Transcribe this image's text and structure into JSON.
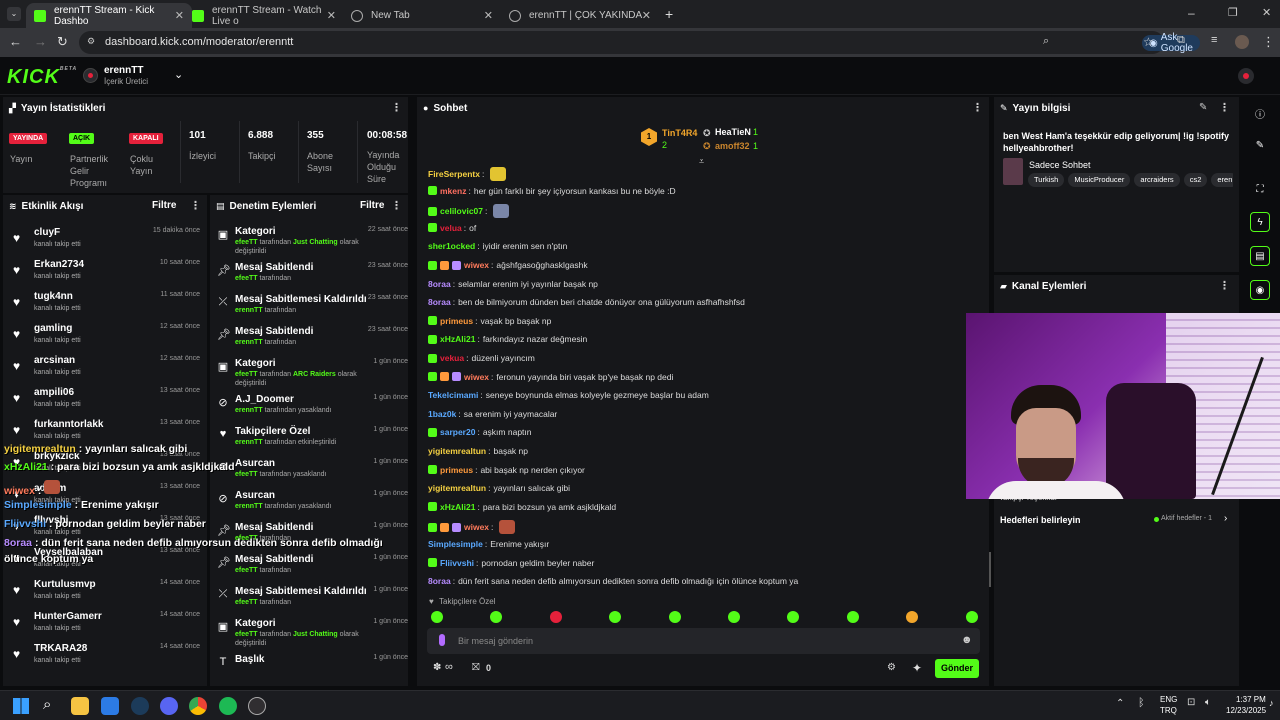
{
  "browser": {
    "tabs": [
      {
        "title": "erennTT Stream - Kick Dashbo",
        "active": true,
        "icon": "kick-icon"
      },
      {
        "title": "erennTT Stream - Watch Live o",
        "active": false,
        "icon": "kick-icon"
      },
      {
        "title": "New Tab",
        "active": false,
        "icon": "globe-icon"
      },
      {
        "title": "erennTT | ÇOK YAKINDA",
        "active": false,
        "icon": "globe-icon"
      }
    ],
    "url": "dashboard.kick.com/moderator/erenntt",
    "ask_google": "Ask Google"
  },
  "header": {
    "logo": "KICK",
    "logo_beta": "BETA",
    "channel_name": "erennTT",
    "channel_role": "İçerik Üretici"
  },
  "stats": {
    "title": "Yayın İstatistikleri",
    "badges": [
      {
        "badge": "YAYINDA",
        "label": "Yayın",
        "color": "#e5213b",
        "text_color": "#ffffff"
      },
      {
        "badge": "AÇIK",
        "label": "Partnerlik Gelir Programı",
        "color": "#53fc18",
        "text_color": "#000000"
      },
      {
        "badge": "KAPALI",
        "label": "Çoklu Yayın",
        "color": "#e5213b",
        "text_color": "#ffffff"
      }
    ],
    "numbers": [
      {
        "value": "101",
        "label": "İzleyici"
      },
      {
        "value": "6.888",
        "label": "Takipçi"
      },
      {
        "value": "355",
        "label": "Abone Sayısı"
      },
      {
        "value": "00:08:58",
        "label": "Yayında Olduğu Süre"
      }
    ]
  },
  "activity": {
    "title": "Etkinlik Akışı",
    "filter": "Filtre",
    "items": [
      {
        "name": "cluyF",
        "sub": "kanalı takip etti",
        "time": "15 dakika önce"
      },
      {
        "name": "Erkan2734",
        "sub": "kanalı takip etti",
        "time": "10 saat önce"
      },
      {
        "name": "tugk4nn",
        "sub": "kanalı takip etti",
        "time": "11 saat önce"
      },
      {
        "name": "gamling",
        "sub": "kanalı takip etti",
        "time": "12 saat önce"
      },
      {
        "name": "arcsinan",
        "sub": "kanalı takip etti",
        "time": "12 saat önce"
      },
      {
        "name": "ampili06",
        "sub": "kanalı takip etti",
        "time": "13 saat önce"
      },
      {
        "name": "furkanntorlakk",
        "sub": "kanalı takip etti",
        "time": "13 saat önce"
      },
      {
        "name": "brkykzlck",
        "sub": "kanalı takip etti",
        "time": "13 saat önce"
      },
      {
        "name": "adsnm",
        "sub": "kanalı takip etti",
        "time": "13 saat önce"
      },
      {
        "name": "fllvvshi",
        "sub": "kanalı takip etti",
        "time": "13 saat önce"
      },
      {
        "name": "Veyselbalaban",
        "sub": "kanalı takip etti",
        "time": "13 saat önce"
      },
      {
        "name": "Kurtulusmvp",
        "sub": "kanalı takip etti",
        "time": "14 saat önce"
      },
      {
        "name": "HunterGamerr",
        "sub": "kanalı takip etti",
        "time": "14 saat önce"
      },
      {
        "name": "TRKARA28",
        "sub": "kanalı takip etti",
        "time": "14 saat önce"
      }
    ]
  },
  "moderation": {
    "title": "Denetim Eylemleri",
    "filter": "Filtre",
    "items": [
      {
        "icon": "category-icon",
        "title": "Kategori",
        "time": "22 saat önce",
        "actor": "efeeTT",
        "mid": " tarafından ",
        "highlight": "Just Chatting",
        "rest": " olarak değiştirildi"
      },
      {
        "icon": "pin-icon",
        "title": "Mesaj Sabitlendi",
        "time": "23 saat önce",
        "actor": "efeeTT",
        "mid": " tarafından",
        "highlight": "",
        "rest": ""
      },
      {
        "icon": "unpin-icon",
        "title": "Mesaj Sabitlemesi Kaldırıldı",
        "time": "23 saat önce",
        "actor": "erennTT",
        "mid": " tarafından",
        "highlight": "",
        "rest": ""
      },
      {
        "icon": "pin-icon",
        "title": "Mesaj Sabitlendi",
        "time": "23 saat önce",
        "actor": "erennTT",
        "mid": " tarafından",
        "highlight": "",
        "rest": ""
      },
      {
        "icon": "category-icon",
        "title": "Kategori",
        "time": "1 gün önce",
        "actor": "efeeTT",
        "mid": " tarafından ",
        "highlight": "ARC Raiders",
        "rest": " olarak değiştirildi"
      },
      {
        "icon": "ban-icon",
        "title": "A.J_Doomer",
        "time": "1 gün önce",
        "actor": "erennTT",
        "mid": " tarafından yasaklandı",
        "highlight": "",
        "rest": ""
      },
      {
        "icon": "heart-icon",
        "title": "Takipçilere Özel",
        "time": "1 gün önce",
        "actor": "erennTT",
        "mid": " tarafından etkinleştirildi",
        "highlight": "",
        "rest": ""
      },
      {
        "icon": "ban-icon",
        "title": "Asurcan",
        "time": "1 gün önce",
        "actor": "efeeTT",
        "mid": " tarafından yasaklandı",
        "highlight": "",
        "rest": ""
      },
      {
        "icon": "ban-icon",
        "title": "Asurcan",
        "time": "1 gün önce",
        "actor": "erennTT",
        "mid": " tarafından yasaklandı",
        "highlight": "",
        "rest": ""
      },
      {
        "icon": "pin-icon",
        "title": "Mesaj Sabitlendi",
        "time": "1 gün önce",
        "actor": "efeeTT",
        "mid": " tarafından",
        "highlight": "",
        "rest": ""
      },
      {
        "icon": "pin-icon",
        "title": "Mesaj Sabitlendi",
        "time": "1 gün önce",
        "actor": "efeeTT",
        "mid": " tarafından",
        "highlight": "",
        "rest": ""
      },
      {
        "icon": "unpin-icon",
        "title": "Mesaj Sabitlemesi Kaldırıldı",
        "time": "1 gün önce",
        "actor": "efeeTT",
        "mid": " tarafından",
        "highlight": "",
        "rest": ""
      },
      {
        "icon": "category-icon",
        "title": "Kategori",
        "time": "1 gün önce",
        "actor": "efeeTT",
        "mid": " tarafından ",
        "highlight": "Just Chatting",
        "rest": " olarak değiştirildi"
      },
      {
        "icon": "title-icon",
        "title": "Başlık",
        "time": "1 gün önce",
        "actor": "",
        "mid": "",
        "highlight": "",
        "rest": ""
      }
    ]
  },
  "chat": {
    "title": "Sohbet",
    "top_gifters": [
      {
        "name": "TinT4R4",
        "count": "2"
      },
      {
        "name": "HeaTieN",
        "count": "1"
      },
      {
        "name": "amoff32",
        "count": "1"
      }
    ],
    "messages": [
      {
        "user": "FireSerpentx",
        "color": "#f5d142",
        "text": "",
        "badges": 0,
        "emote": "#e2c431"
      },
      {
        "user": "mkenz",
        "color": "#ff6f61",
        "text": "her gün farklı bir şey içiyorsun kankası bu ne böyle :D",
        "badges": 1
      },
      {
        "user": "celilovic07",
        "color": "#53fc18",
        "text": "",
        "badges": 1,
        "emote": "#7a86a8"
      },
      {
        "user": "velua",
        "color": "#e5213b",
        "text": "of",
        "badges": 1
      },
      {
        "user": "sher1ocked",
        "color": "#53fc18",
        "text": "iyidir erenim sen n'ptın",
        "badges": 0
      },
      {
        "user": "wiwex",
        "color": "#ff7b5c",
        "text": "ağshfgasoğghasklgashk",
        "badges": 3
      },
      {
        "user": "8oraa",
        "color": "#b78cff",
        "text": "selamlar erenim iyi yayınlar başak np",
        "badges": 0
      },
      {
        "user": "8oraa",
        "color": "#b78cff",
        "text": "ben de bilmiyorum dünden beri chatde dönüyor ona gülüyorum asfhafhshfsd",
        "badges": 0
      },
      {
        "user": "primeus",
        "color": "#ff9a3c",
        "text": "vaşak bp başak np",
        "badges": 1
      },
      {
        "user": "xHzAli21",
        "color": "#53fc18",
        "text": "farkındayız nazar değmesin",
        "badges": 1
      },
      {
        "user": "vekua",
        "color": "#e5213b",
        "text": "düzenli yayıncım",
        "badges": 1
      },
      {
        "user": "wiwex",
        "color": "#ff7b5c",
        "text": "feronun yayında biri vaşak bp'ye başak np dedi",
        "badges": 3
      },
      {
        "user": "Tekelcimami",
        "color": "#5aa9ff",
        "text": "seneye boynunda elmas kolyeyle gezmeye başlar bu adam",
        "badges": 0
      },
      {
        "user": "1baz0k",
        "color": "#5aa9ff",
        "text": "sa erenim iyi yaymacalar",
        "badges": 0
      },
      {
        "user": "sarper20",
        "color": "#5aa9ff",
        "text": "aşkım naptın",
        "badges": 1
      },
      {
        "user": "yigitemrealtun",
        "color": "#f5d142",
        "text": "başak np",
        "badges": 0
      },
      {
        "user": "primeus",
        "color": "#ff9a3c",
        "text": "abi başak np nerden çıkıyor",
        "badges": 1
      },
      {
        "user": "yigitemrealtun",
        "color": "#f5d142",
        "text": "yayınları salıcak gibi",
        "badges": 0
      },
      {
        "user": "xHzAli21",
        "color": "#53fc18",
        "text": "para bizi bozsun ya amk asjkldjkald",
        "badges": 1
      },
      {
        "user": "wiwex",
        "color": "#ff7b5c",
        "text": "",
        "badges": 3,
        "emote": "#b5523b"
      },
      {
        "user": "Simplesimple",
        "color": "#5aa9ff",
        "text": "Erenime yakışır",
        "badges": 0
      },
      {
        "user": "Fliivvshi",
        "color": "#5aa9ff",
        "text": "pornodan geldim beyler naber",
        "badges": 1
      },
      {
        "user": "8oraa",
        "color": "#b78cff",
        "text": "dün ferit sana neden defib almıyorsun dedikten sonra defib olmadığı için ölünce koptum ya",
        "badges": 0
      }
    ],
    "follower_only": "Takipçilere Özel",
    "input_placeholder": "Bir mesaj gönderin",
    "points": "∞",
    "gift_count": "0",
    "send_label": "Gönder"
  },
  "stream_info": {
    "title": "Yayın bilgisi",
    "stream_title": "ben West Ham'a teşekkür edip geliyorum| !ig !spotify hellyeahbrother!",
    "mode": "Sadece Sohbet",
    "tags": [
      "Turkish",
      "MusicProducer",
      "arcraiders",
      "cs2",
      "eren"
    ]
  },
  "channel_actions": {
    "title": "Kanal Eylemleri",
    "partial_label": "Takipçi Teşekkür",
    "goals_label": "Hedefleri belirleyin",
    "goals_status": "Aktif hedefler - 1"
  },
  "overlay_chat": [
    {
      "user": "yigitemrealtun",
      "color": "#f5d142",
      "text": " : yayınları salıcak gibi"
    },
    {
      "user": "xHzAli21",
      "color": "#53fc18",
      "text": " : para bizi bozsun ya amk asjkldjkald"
    },
    {
      "user": "wiwex",
      "color": "#ff7b5c",
      "text": " :"
    },
    {
      "user": "Simplesimple",
      "color": "#5aa9ff",
      "text": " : Erenime yakışır"
    },
    {
      "user": "Fliivvshi",
      "color": "#5aa9ff",
      "text": " : pornodan geldim beyler naber"
    },
    {
      "user": "8oraa",
      "color": "#b78cff",
      "text": " : dün ferit sana neden defib almıyorsun dedikten sonra defib olmadığı"
    },
    {
      "user": "",
      "color": "#ffffff",
      "text": "ölünce koptum ya"
    }
  ],
  "taskbar": {
    "lang": "ENG",
    "lang2": "TRQ",
    "time": "1:37 PM",
    "date": "12/23/2025"
  }
}
